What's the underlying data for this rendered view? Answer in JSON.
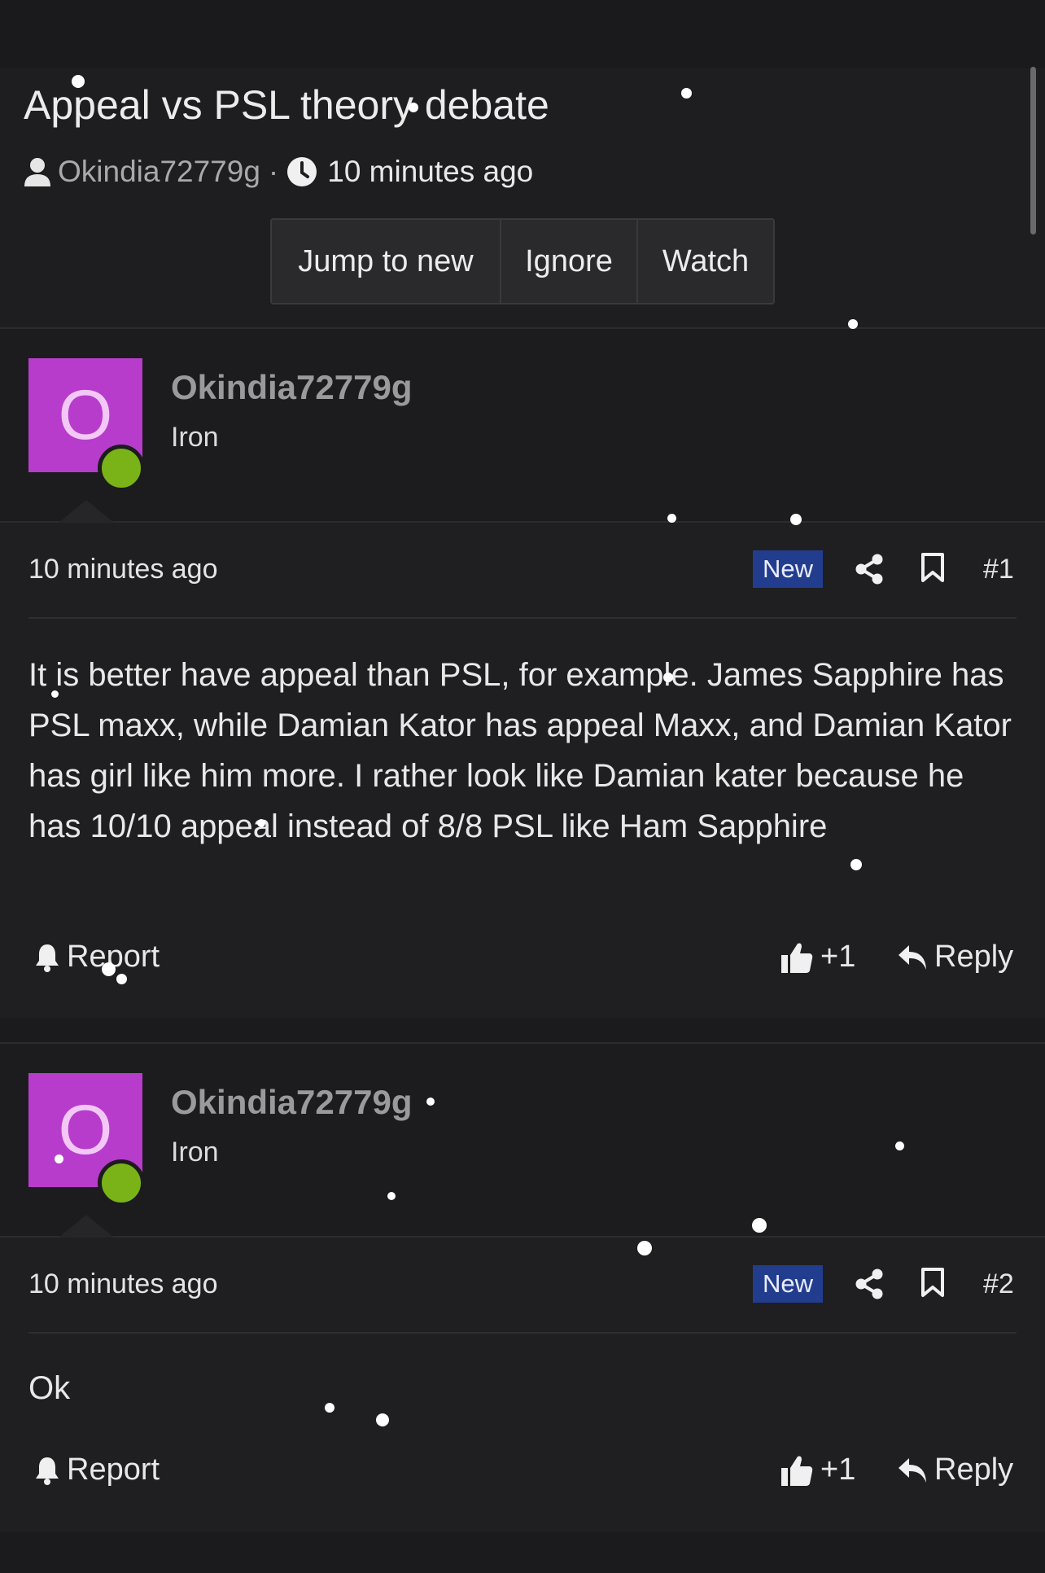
{
  "thread": {
    "title": "Appeal vs PSL theory debate",
    "author": "Okindia72779g",
    "separator": "·",
    "time": "10 minutes ago"
  },
  "actions": {
    "jump_label": "Jump to new",
    "ignore_label": "Ignore",
    "watch_label": "Watch"
  },
  "posts": [
    {
      "avatar_letter": "O",
      "username": "Okindia72779g",
      "rank": "Iron",
      "time": "10 minutes ago",
      "badge": "New",
      "number": "#1",
      "body": "It is better have appeal than PSL, for example. James Sapphire has PSL maxx, while Damian Kator has appeal Maxx, and Damian Kator has girl like him more. I rather look like Damian kater because he has 10/10 appeal instead of 8/8 PSL like Ham Sapphire",
      "report_label": "Report",
      "like_label": "+1",
      "reply_label": "Reply"
    },
    {
      "avatar_letter": "O",
      "username": "Okindia72779g",
      "rank": "Iron",
      "time": "10 minutes ago",
      "badge": "New",
      "number": "#2",
      "body": "Ok",
      "report_label": "Report",
      "like_label": "+1",
      "reply_label": "Reply"
    }
  ],
  "icons": {
    "author": "user-icon",
    "time": "clock-icon",
    "share": "share-icon",
    "bookmark": "bookmark-icon",
    "report": "bell-icon",
    "like": "thumbs-up-icon",
    "reply": "reply-icon"
  },
  "colors": {
    "avatar": "#b83ccc",
    "online": "#7ab317",
    "new_badge": "#233d8e"
  }
}
